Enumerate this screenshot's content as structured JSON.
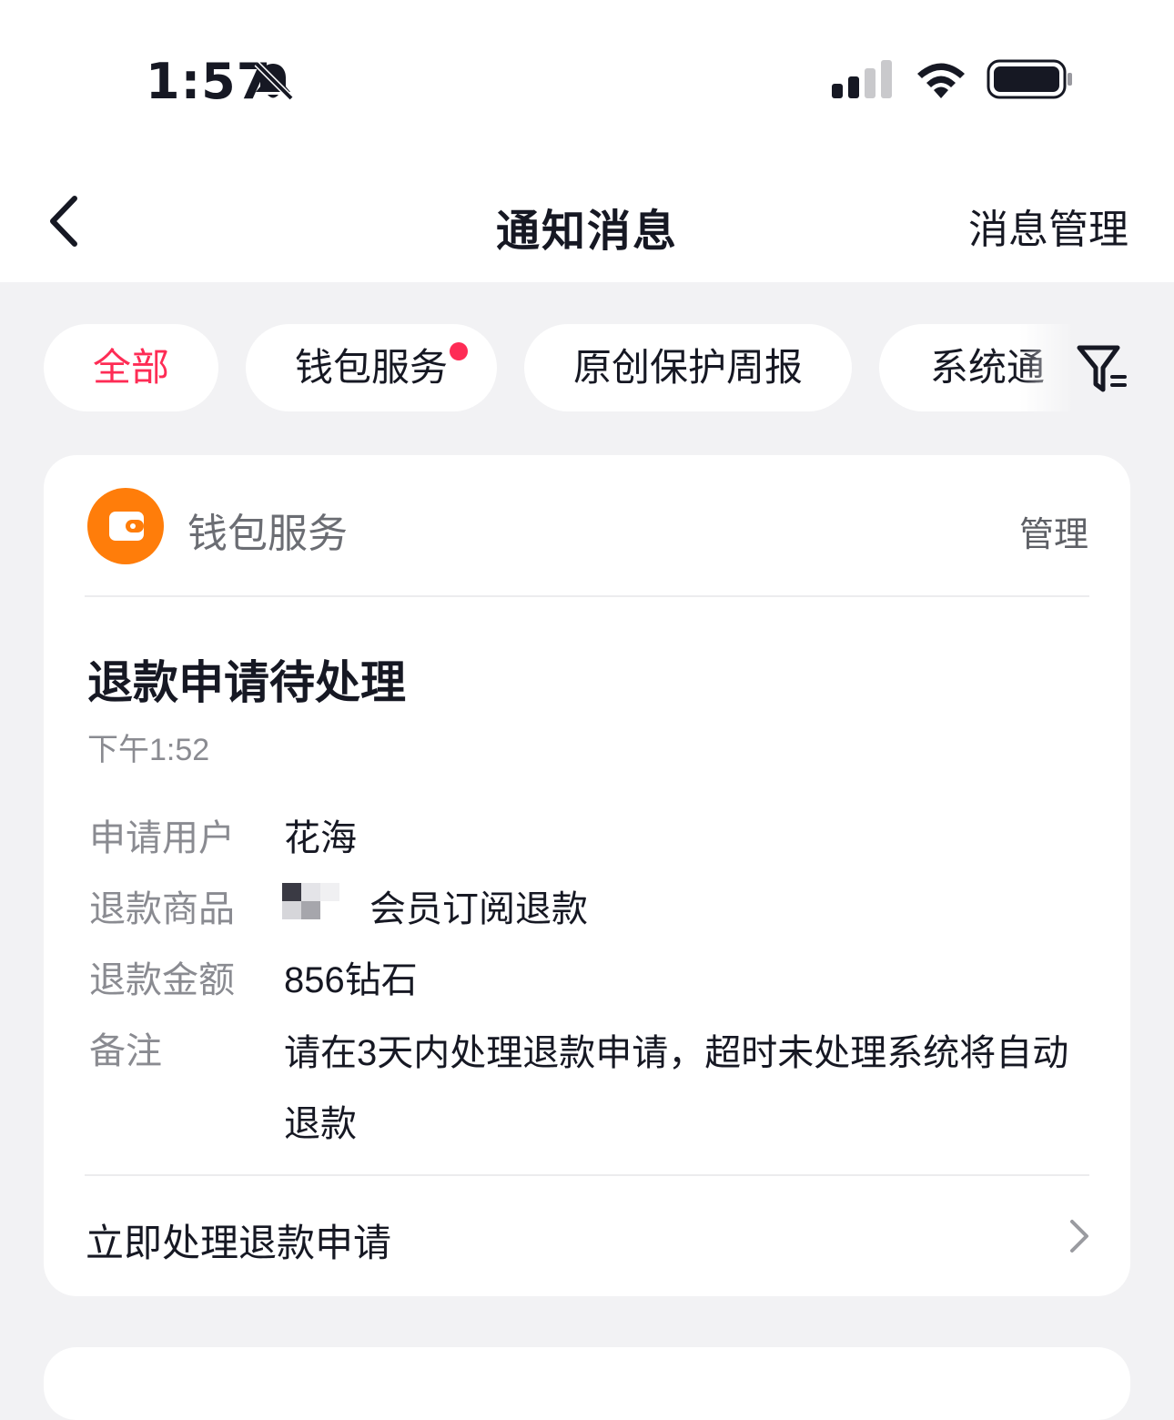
{
  "status_bar": {
    "time": "1:57",
    "icons": [
      "bell-slash-icon",
      "cellular-signal-icon",
      "wifi-icon",
      "battery-icon"
    ]
  },
  "nav": {
    "back_icon": "chevron-left-icon",
    "title": "通知消息",
    "manage_label": "消息管理"
  },
  "tabs": [
    {
      "label": "全部",
      "active": true
    },
    {
      "label": "钱包服务",
      "badge": true
    },
    {
      "label": "原创保护周报"
    },
    {
      "label": "系统通"
    }
  ],
  "filter_icon": "filter-icon",
  "card": {
    "service": {
      "icon": "wallet-icon",
      "name": "钱包服务",
      "manage_label": "管理"
    },
    "title": "退款申请待处理",
    "time": "下午1:52",
    "rows": [
      {
        "label": "申请用户",
        "value": "花海"
      },
      {
        "label": "退款商品",
        "value": "会员订阅退款"
      },
      {
        "label": "退款金额",
        "value": "856钻石"
      },
      {
        "label": "备注",
        "value": "请在3天内处理退款申请，超时未处理系统将自动退款"
      }
    ],
    "action_label": "立即处理退款申请"
  },
  "colors": {
    "accent": "#fe2c55",
    "wallet_orange": "#ff7d0a",
    "background": "#f2f2f4"
  }
}
